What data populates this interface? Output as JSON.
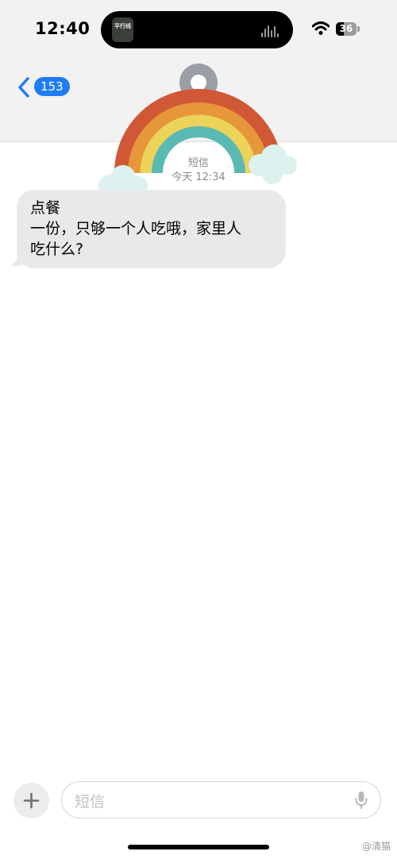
{
  "status_bar": {
    "time": "12:40",
    "battery_level": "36",
    "album_text": "平行线"
  },
  "nav": {
    "unread_count": "153"
  },
  "conversation": {
    "sender": "短信",
    "timestamp": "今天 12:34",
    "message_lines": [
      "点餐",
      "一份，只够一个人吃哦，家里人",
      "吃什么?"
    ]
  },
  "composer": {
    "placeholder": "短信"
  },
  "watermark": "@清猫",
  "colors": {
    "accent": "#1f7cf5",
    "bubble": "#e9e9eb",
    "header_bg": "#f2f2f3",
    "secondary_text": "#8a8a8e"
  },
  "icons": [
    "wifi-icon",
    "battery-icon",
    "chevron-left-icon",
    "rainbow-sticker",
    "plus-icon",
    "mic-icon"
  ]
}
